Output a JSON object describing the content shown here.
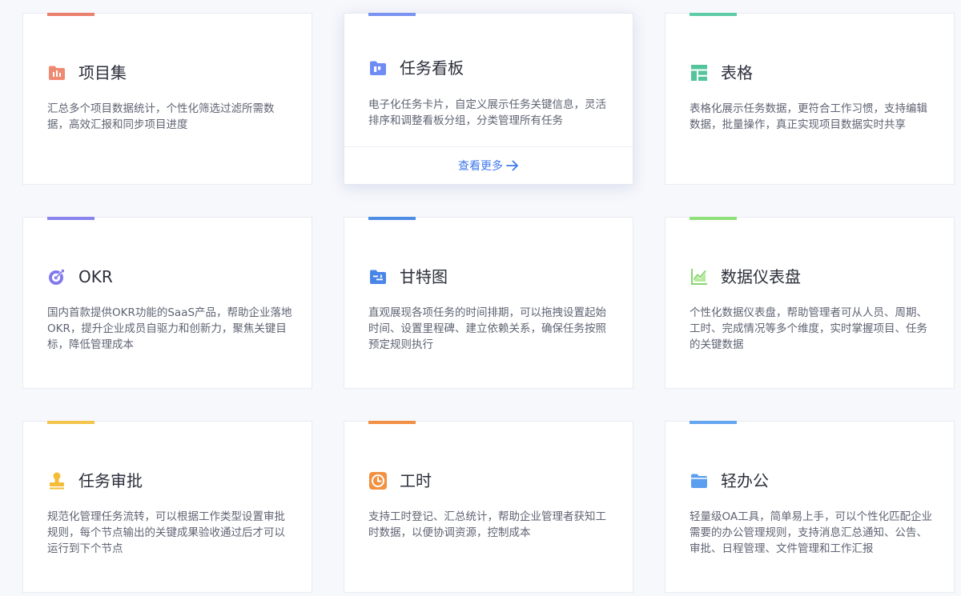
{
  "cards": [
    {
      "title": "项目集",
      "desc": "汇总多个项目数据统计，个性化筛选过滤所需数据，高效汇报和同步项目进度",
      "icon": "project-set-icon",
      "accent": "#ea7f6d",
      "icon_color": "#ef8a72"
    },
    {
      "title": "任务看板",
      "desc": "电子化任务卡片，自定义展示任务关键信息，灵活排序和调整看板分组，分类管理所有任务",
      "icon": "task-board-icon",
      "accent": "#7a93f0",
      "icon_color": "#6f8cf5",
      "more_label": "查看更多"
    },
    {
      "title": "表格",
      "desc": "表格化展示任务数据，更符合工作习惯，支持编辑数据，批量操作，真正实现项目数据实时共享",
      "icon": "table-icon",
      "accent": "#5ecba7",
      "icon_color": "#54c49c"
    },
    {
      "title": "OKR",
      "desc": "国内首款提供OKR功能的SaaS产品，帮助企业落地OKR，提升企业成员自驱力和创新力，聚焦关键目标，降低管理成本",
      "icon": "okr-target-icon",
      "accent": "#8a84ee",
      "icon_color": "#8078ec"
    },
    {
      "title": "甘特图",
      "desc": "直观展现各项任务的时间排期，可以拖拽设置起始时间、设置里程碑、建立依赖关系，确保任务按照预定规则执行",
      "icon": "gantt-chart-icon",
      "accent": "#4e8de4",
      "icon_color": "#4a86e8"
    },
    {
      "title": "数据仪表盘",
      "desc": "个性化数据仪表盘，帮助管理者可从人员、周期、工时、完成情况等多个维度，实时掌握项目、任务的关键数据",
      "icon": "dashboard-chart-icon",
      "accent": "#8fe07a",
      "icon_color": "#86d66f"
    },
    {
      "title": "任务审批",
      "desc": "规范化管理任务流转，可以根据工作类型设置审批规则，每个节点输出的关键成果验收通过后才可以运行到下个节点",
      "icon": "approval-stamp-icon",
      "accent": "#f3c54c",
      "icon_color": "#f3bd38"
    },
    {
      "title": "工时",
      "desc": "支持工时登记、汇总统计，帮助企业管理者获知工时数据，以便协调资源，控制成本",
      "icon": "clock-icon",
      "accent": "#f18f45",
      "icon_color": "#f19141"
    },
    {
      "title": "轻办公",
      "desc": "轻量级OA工具，简单易上手，可以个性化匹配企业需要的办公管理规则，支持消息汇总通知、公告、审批、日程管理、文件管理和工作汇报",
      "icon": "folder-icon",
      "accent": "#63a6ef",
      "icon_color": "#5b9ef0"
    }
  ]
}
